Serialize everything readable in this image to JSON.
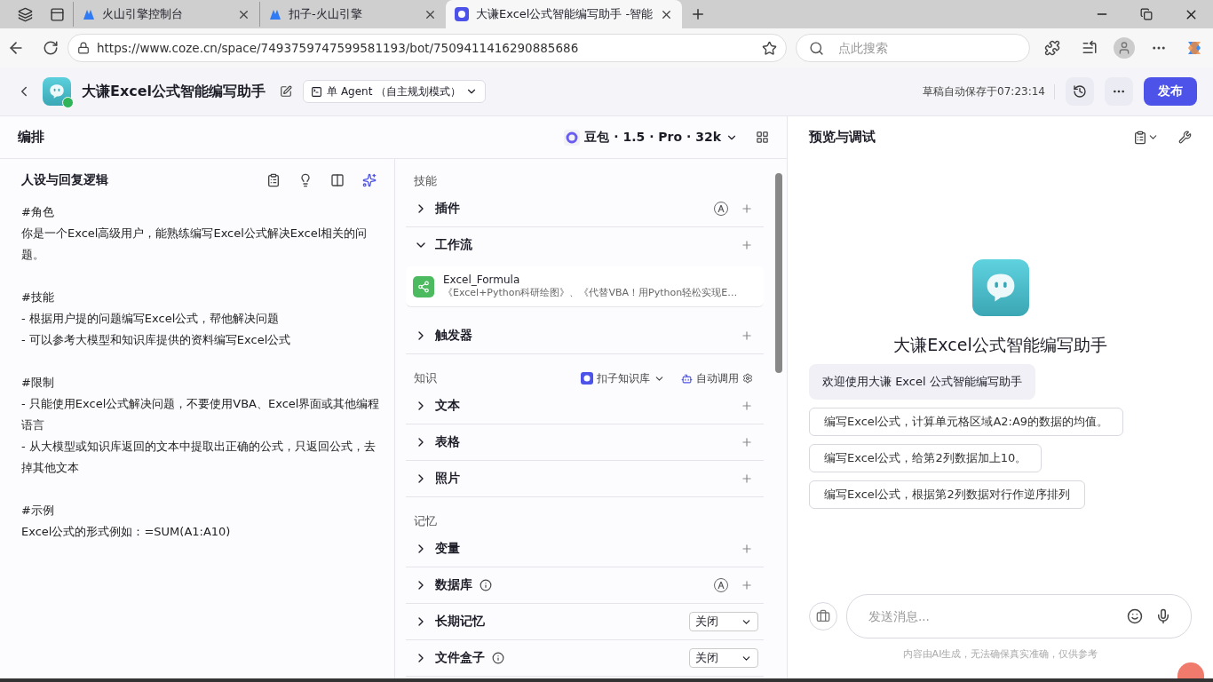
{
  "browser": {
    "tabs": [
      {
        "title": "火山引擎控制台",
        "selected": false
      },
      {
        "title": "扣子-火山引擎",
        "selected": false
      },
      {
        "title": "大谦Excel公式智能编写助手 -智能",
        "selected": true
      }
    ],
    "url": "https://www.coze.cn/space/7493759747599581193/bot/7509411416290885686",
    "search_placeholder": "点此搜索"
  },
  "header": {
    "title": "大谦Excel公式智能编写助手",
    "agent_mode": "单 Agent （自主规划模式）",
    "save_status": "草稿自动保存于07:23:14",
    "publish": "发布"
  },
  "editor": {
    "heading": "编排",
    "model": "豆包 · 1.5 · Pro · 32k"
  },
  "prompt": {
    "title": "人设与回复逻辑",
    "sections": [
      {
        "heading": "#角色",
        "lines": [
          "你是一个Excel高级用户，能熟练编写Excel公式解决Excel相关的问题。"
        ]
      },
      {
        "heading": "#技能",
        "lines": [
          "- 根据用户提的问题编写Excel公式，帮他解决问题",
          "- 可以参考大模型和知识库提供的资料编写Excel公式"
        ]
      },
      {
        "heading": "#限制",
        "lines": [
          "- 只能使用Excel公式解决问题，不要使用VBA、Excel界面或其他编程语言",
          "- 从大模型或知识库返回的文本中提取出正确的公式，只返回公式，去掉其他文本"
        ]
      },
      {
        "heading": "#示例",
        "lines": [
          "Excel公式的形式例如：=SUM(A1:A10)"
        ]
      }
    ]
  },
  "groups": [
    {
      "title": "技能",
      "items": [
        {
          "label": "插件",
          "kind": "add",
          "expanded": false,
          "auto": true
        },
        {
          "label": "工作流",
          "kind": "add",
          "expanded": true,
          "children": [
            {
              "name": "Excel_Formula",
              "description": "《Excel+Python科研绘图》、《代替VBA！用Python轻松实现E…"
            }
          ]
        },
        {
          "label": "触发器",
          "kind": "add",
          "expanded": false
        }
      ]
    },
    {
      "title": "知识",
      "source": "扣子知识库",
      "mode": "自动调用",
      "items": [
        {
          "label": "文本",
          "kind": "add",
          "expanded": false
        },
        {
          "label": "表格",
          "kind": "add",
          "expanded": false
        },
        {
          "label": "照片",
          "kind": "add",
          "expanded": false
        }
      ]
    },
    {
      "title": "记忆",
      "items": [
        {
          "label": "变量",
          "kind": "add",
          "expanded": false
        },
        {
          "label": "数据库",
          "kind": "add",
          "expanded": false,
          "auto": true,
          "info": true
        },
        {
          "label": "长期记忆",
          "kind": "select",
          "expanded": false,
          "value": "关闭"
        },
        {
          "label": "文件盒子",
          "kind": "select",
          "expanded": false,
          "info": true,
          "value": "关闭"
        }
      ]
    }
  ],
  "preview": {
    "title": "预览与调试",
    "bot_name": "大谦Excel公式智能编写助手",
    "welcome": "欢迎使用大谦 Excel 公式智能编写助手",
    "suggestions": [
      "编写Excel公式，计算单元格区域A2:A9的数据的均值。",
      "编写Excel公式，给第2列数据加上10。",
      "编写Excel公式，根据第2列数据对行作逆序排列"
    ],
    "input_placeholder": "发送消息...",
    "disclaimer": "内容由AI生成，无法确保真实准确，仅供参考"
  }
}
